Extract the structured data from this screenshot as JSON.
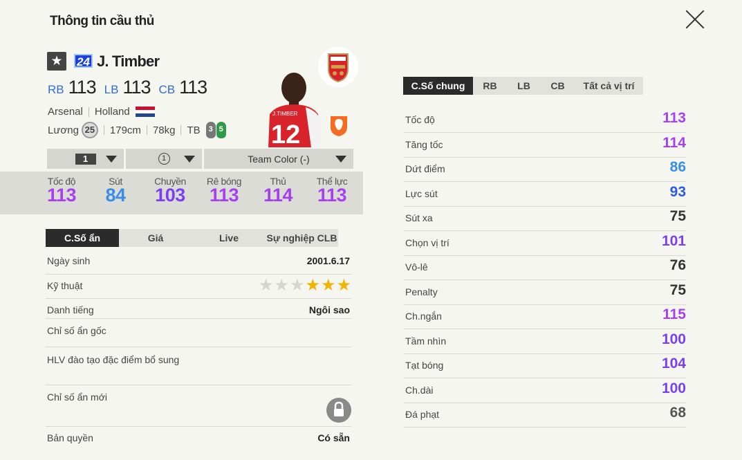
{
  "title": "Thông tin cầu thủ",
  "player": {
    "season": "24",
    "name": "J. Timber",
    "positions": [
      {
        "pos": "RB",
        "ovr": "113"
      },
      {
        "pos": "LB",
        "ovr": "113"
      },
      {
        "pos": "CB",
        "ovr": "113"
      }
    ],
    "club": "Arsenal",
    "nation": "Holland",
    "salary_label": "Lương",
    "salary": "25",
    "height": "179cm",
    "weight": "78kg",
    "body": "TB",
    "weak_foot": "3",
    "strong_foot": "5",
    "fav_icon": "star-icon"
  },
  "controls": {
    "level": "1",
    "enhance": "1",
    "team_color": "Team Color (-)"
  },
  "summary_stats": [
    {
      "label": "Tốc độ",
      "value": "113",
      "color": "#a53ff0"
    },
    {
      "label": "Sút",
      "value": "84",
      "color": "#3a8ee6"
    },
    {
      "label": "Chuyền",
      "value": "103",
      "color": "#7a3ff0"
    },
    {
      "label": "Rê bóng",
      "value": "113",
      "color": "#a53ff0"
    },
    {
      "label": "Thủ",
      "value": "114",
      "color": "#a53ff0"
    },
    {
      "label": "Thể lực",
      "value": "113",
      "color": "#a53ff0"
    }
  ],
  "left_tabs": [
    {
      "label": "C.Số ẩn",
      "active": true
    },
    {
      "label": "Giá",
      "active": false
    },
    {
      "label": "Live",
      "active": false
    },
    {
      "label": "Sự nghiệp CLB",
      "active": false
    }
  ],
  "left_rows": {
    "dob_label": "Ngày sinh",
    "dob": "2001.6.17",
    "skill_label": "Kỹ thuật",
    "skill_stars": 3,
    "rep_label": "Danh tiếng",
    "rep": "Ngôi sao",
    "hidden_orig": "Chỉ số ẩn gốc",
    "coach": "HLV đào tạo đặc điểm bổ sung",
    "hidden_new": "Chỉ số ẩn mới",
    "copyright_label": "Bản quyền",
    "copyright": "Có sẵn"
  },
  "right_tabs": [
    {
      "label": "C.Số chung",
      "active": true
    },
    {
      "label": "RB",
      "active": false
    },
    {
      "label": "LB",
      "active": false
    },
    {
      "label": "CB",
      "active": false
    },
    {
      "label": "Tất cả vị trí",
      "active": false
    }
  ],
  "right_stats": [
    {
      "label": "Tốc độ",
      "value": "113",
      "color": "#a53ff0"
    },
    {
      "label": "Tăng tốc",
      "value": "114",
      "color": "#a53ff0"
    },
    {
      "label": "Dứt điểm",
      "value": "86",
      "color": "#3a8ee6"
    },
    {
      "label": "Lực sút",
      "value": "93",
      "color": "#2e59e0"
    },
    {
      "label": "Sút xa",
      "value": "75",
      "color": "#333333"
    },
    {
      "label": "Chọn vị trí",
      "value": "101",
      "color": "#7a3ff0"
    },
    {
      "label": "Vô-lê",
      "value": "76",
      "color": "#333333"
    },
    {
      "label": "Penalty",
      "value": "75",
      "color": "#333333"
    },
    {
      "label": "Ch.ngắn",
      "value": "115",
      "color": "#a53ff0"
    },
    {
      "label": "Tầm nhìn",
      "value": "100",
      "color": "#7a3ff0"
    },
    {
      "label": "Tạt bóng",
      "value": "104",
      "color": "#7a3ff0"
    },
    {
      "label": "Ch.dài",
      "value": "100",
      "color": "#7a3ff0"
    },
    {
      "label": "Đá phạt",
      "value": "68",
      "color": "#555555"
    }
  ]
}
